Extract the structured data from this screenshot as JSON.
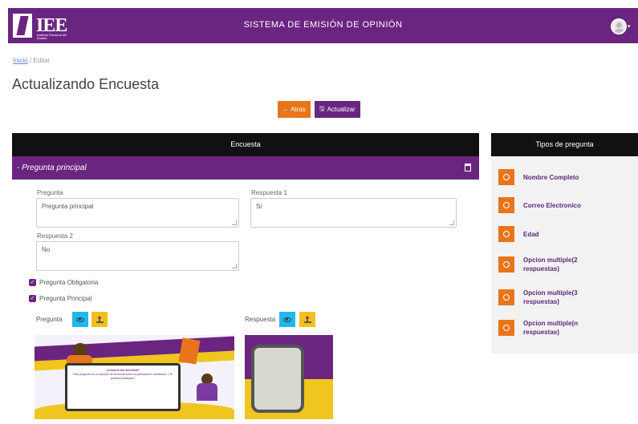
{
  "header": {
    "logo_text": "IEE",
    "logo_subtext": "Instituto Electoral del Estado",
    "app_title": "SISTEMA DE EMISIÓN DE OPINIÓN"
  },
  "breadcrumb": {
    "home": "Inicio",
    "separator": "/",
    "current": "Editar"
  },
  "page_title": "Actualizando Encuesta",
  "toolbar": {
    "back_label": "← Atras",
    "update_label": "Actualizar"
  },
  "main_card": {
    "header": "Encuesta",
    "question_title": "- Pregunta principal",
    "fields": {
      "pregunta_label": "Pregunta",
      "pregunta_value": "Pregunta principal",
      "respuesta1_label": "Respuesta 1",
      "respuesta1_value": "Si",
      "respuesta2_label": "Respuesta 2",
      "respuesta2_value": "No"
    },
    "checkboxes": {
      "obligatoria": "Pregunta Obligatoria",
      "principal": "Pregunta Principal"
    },
    "image_labels": {
      "pregunta": "Pregunta",
      "respuesta": "Respuesta"
    },
    "image_text": {
      "heading": "¿Conoces tus derechos?",
      "body": "Esta pregunta es un ejemplo de encuesta sobre la participación ciudadana, ¿Te gustaría participar?"
    }
  },
  "side_card": {
    "header": "Tipos de pregunta",
    "items": [
      {
        "label": "Nombre Completo"
      },
      {
        "label": "Correo Electronico"
      },
      {
        "label": "Edad"
      },
      {
        "label": "Opcion multiple(2 respuestas)"
      },
      {
        "label": "Opcion multiple(3 respuestas)"
      },
      {
        "label": "Opcion multiple(n respuestas)"
      }
    ]
  },
  "colors": {
    "brand_purple": "#6a2580",
    "accent_orange": "#e8751a",
    "view_blue": "#22b7e8",
    "upload_yellow": "#f0c020",
    "header_black": "#111111"
  },
  "icons": [
    "user-avatar-icon",
    "back-arrow-icon",
    "save-icon",
    "trash-icon",
    "eye-icon",
    "upload-icon",
    "plus-circle-icon"
  ]
}
